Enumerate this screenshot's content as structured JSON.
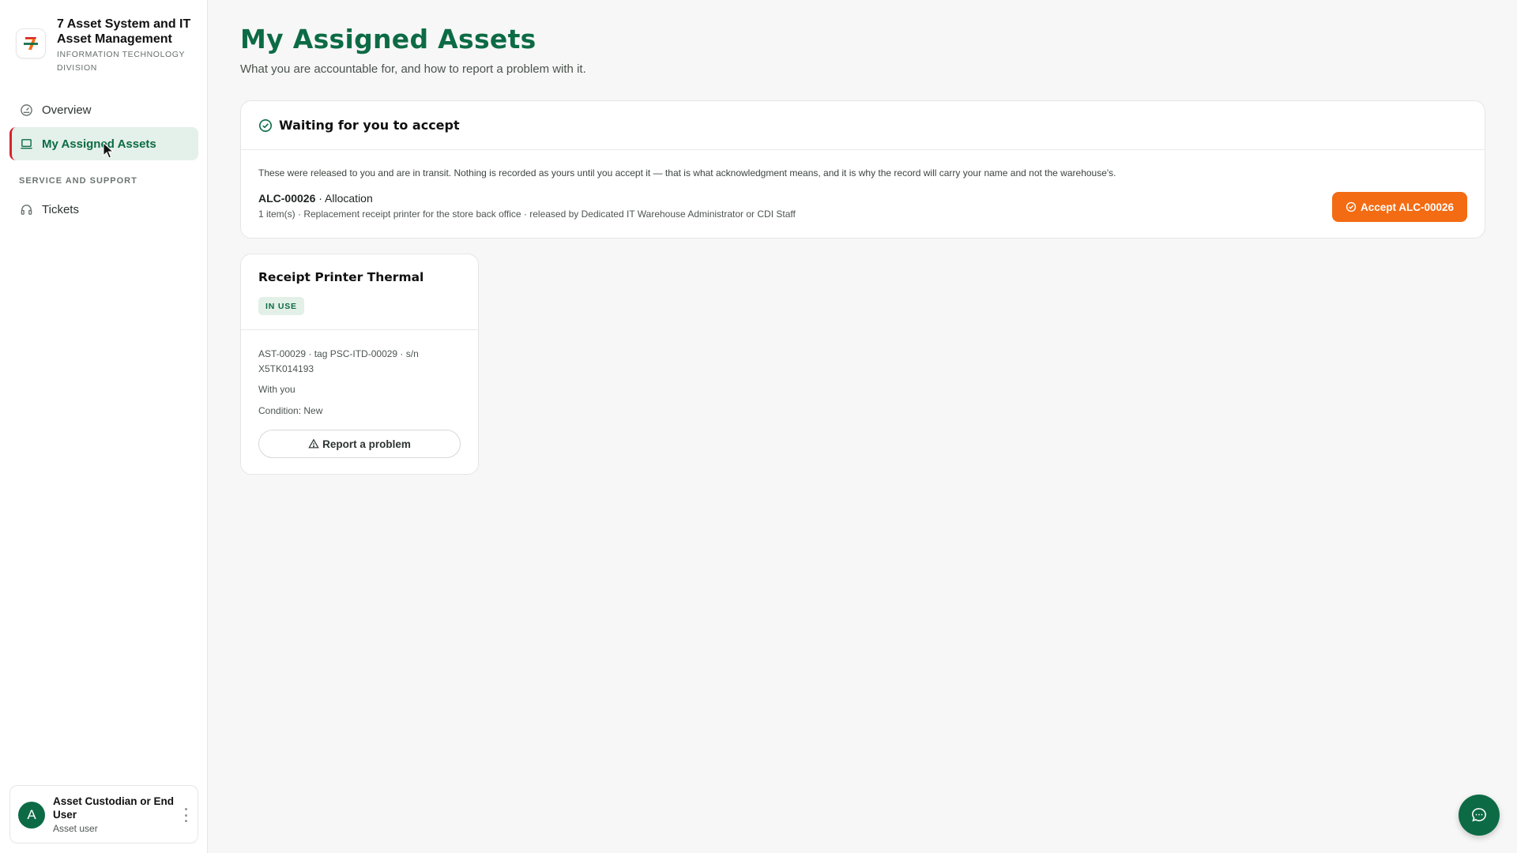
{
  "app": {
    "title": "7 Asset System and IT Asset Management",
    "division": "INFORMATION TECHNOLOGY DIVISION",
    "logo_text": "7-ELEVEN",
    "colors": {
      "brand_green": "#0c6b45",
      "accent_red": "#d5242d",
      "accent_orange": "#f36b12"
    }
  },
  "sidebar": {
    "items": [
      {
        "label": "Overview",
        "icon": "gauge-icon"
      },
      {
        "label": "My Assigned Assets",
        "icon": "laptop-icon",
        "active": true
      }
    ],
    "section_label": "SERVICE AND SUPPORT",
    "support_items": [
      {
        "label": "Tickets",
        "icon": "headset-icon"
      }
    ]
  },
  "user": {
    "initial": "A",
    "name": "Asset Custodian or End User",
    "role": "Asset user"
  },
  "page": {
    "title": "My Assigned Assets",
    "subtitle": "What you are accountable for, and how to report a problem with it."
  },
  "pending": {
    "title": "Waiting for you to accept",
    "note": "These were released to you and are in transit. Nothing is recorded as yours until you accept it — that is what acknowledgment means, and it is why the record will carry your name and not the warehouse's.",
    "allocation_id": "ALC-00026",
    "allocation_type": "· Allocation",
    "description": "1 item(s) · Replacement receipt printer for the store back office · released by Dedicated IT Warehouse Administrator or CDI Staff",
    "accept_label": "Accept ALC-00026"
  },
  "assets": [
    {
      "name": "Receipt Printer Thermal",
      "status": "IN USE",
      "ids": "AST-00029 · tag PSC-ITD-00029 · s/n X5TK014193",
      "holder": "With you",
      "condition": "Condition: New",
      "report_label": "Report a problem"
    }
  ]
}
